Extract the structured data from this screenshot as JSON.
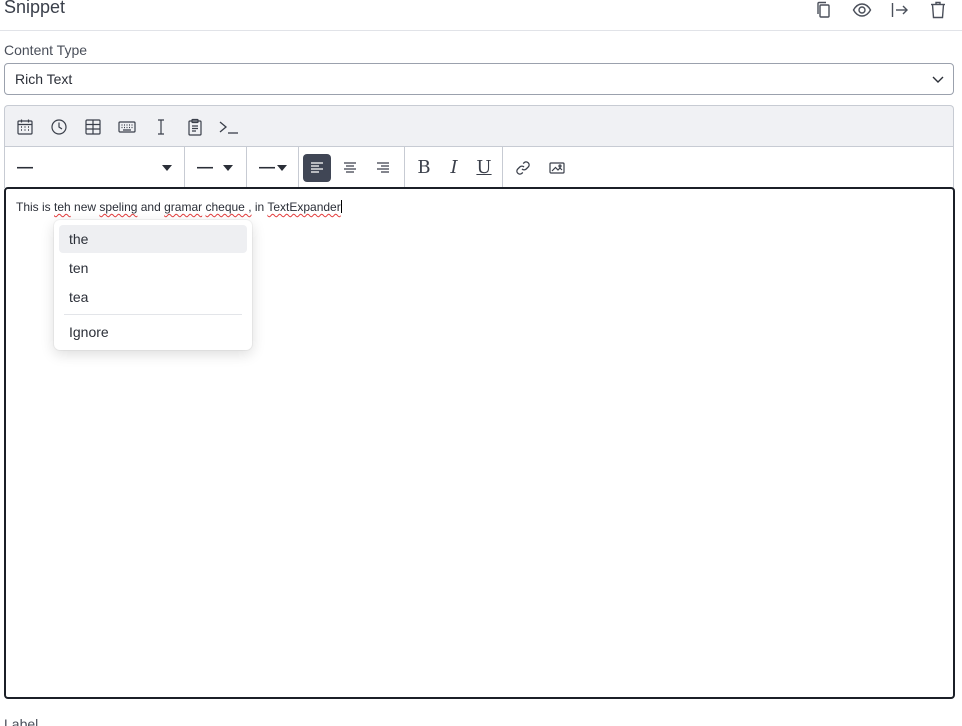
{
  "header": {
    "title": "Snippet",
    "actions": [
      {
        "name": "copy-icon"
      },
      {
        "name": "eye-icon"
      },
      {
        "name": "export-icon"
      },
      {
        "name": "trash-icon"
      }
    ]
  },
  "content_type": {
    "label": "Content Type",
    "value": "Rich Text"
  },
  "toolbar_insert": [
    "calendar-icon",
    "clock-icon",
    "form-icon",
    "keyboard-icon",
    "text-cursor-icon",
    "clipboard-icon",
    "terminal-icon"
  ],
  "toolbar_format": {
    "font_family_value": "—",
    "font_size_value": "—",
    "line_height_value": "—",
    "alignment_selected": "left",
    "bold_label": "B",
    "italic_label": "I",
    "underline_label": "U"
  },
  "editor": {
    "segments": [
      {
        "text": "This is ",
        "misspelled": false
      },
      {
        "text": "teh",
        "misspelled": true
      },
      {
        "text": " new ",
        "misspelled": false
      },
      {
        "text": "speling",
        "misspelled": true
      },
      {
        "text": " and ",
        "misspelled": false
      },
      {
        "text": "gramar",
        "misspelled": true
      },
      {
        "text": " ",
        "misspelled": false
      },
      {
        "text": "cheque ,",
        "misspelled": true
      },
      {
        "text": " in ",
        "misspelled": false
      },
      {
        "text": "TextExpander",
        "misspelled": true
      }
    ]
  },
  "spellcheck_popup": {
    "suggestions": [
      "the",
      "ten",
      "tea"
    ],
    "highlighted_index": 0,
    "ignore_label": "Ignore"
  },
  "next_field_label": "Label",
  "colors": {
    "accent_dark": "#404655",
    "border": "#c7cbd3",
    "spell_error": "#e33b3b"
  }
}
